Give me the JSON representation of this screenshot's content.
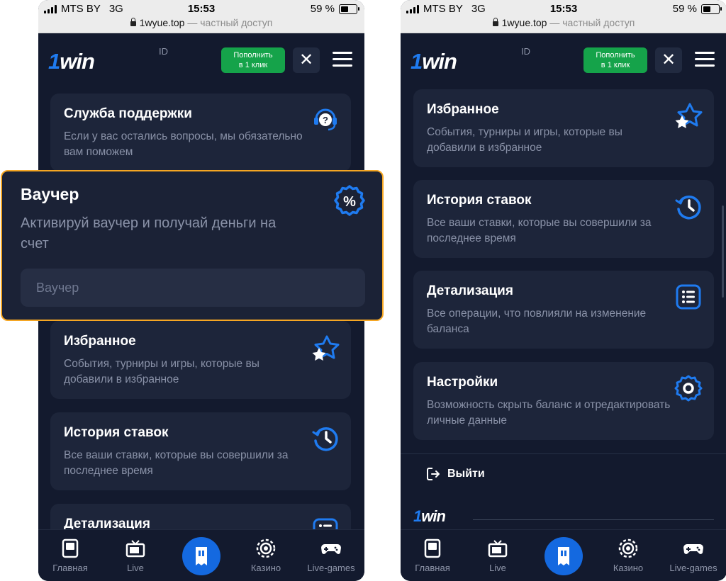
{
  "status_bar": {
    "carrier": "MTS BY",
    "network": "3G",
    "time": "15:53",
    "battery": "59 %",
    "url_domain": "1wyue.top",
    "url_suffix": "— частный доступ"
  },
  "header": {
    "logo_one": "1",
    "logo_win": "win",
    "id_label": "ID",
    "deposit_line1": "Пополнить",
    "deposit_line2": "в 1 клик",
    "close_symbol": "✕"
  },
  "left_cards": {
    "support": {
      "title": "Служба поддержки",
      "desc": "Если у вас остались вопросы, мы обязательно вам поможем",
      "icon": "headset-question-icon"
    },
    "favorites": {
      "title": "Избранное",
      "desc": "События, турниры и игры, которые вы добавили в избранное",
      "icon": "star-icon"
    },
    "history": {
      "title": "История ставок",
      "desc": "Все ваши ставки, которые вы совершили за последнее время",
      "icon": "history-clock-icon"
    },
    "details": {
      "title": "Детализация",
      "icon": "list-icon"
    }
  },
  "voucher": {
    "title": "Ваучер",
    "desc": "Активируй ваучер и получай деньги на счет",
    "placeholder": "Ваучер",
    "icon": "percent-badge-icon",
    "highlight_color": "#f5a623"
  },
  "right_cards": {
    "favorites": {
      "title": "Избранное",
      "desc": "События, турниры и игры, которые вы добавили в избранное",
      "icon": "star-icon"
    },
    "history": {
      "title": "История ставок",
      "desc": "Все ваши ставки, которые вы совершили за последнее время",
      "icon": "history-clock-icon"
    },
    "details": {
      "title": "Детализация",
      "desc": "Все операции, что повлияли на изменение баланса",
      "icon": "list-icon"
    },
    "settings": {
      "title": "Настройки",
      "desc": "Возможность скрыть баланс и отредактировать личные данные",
      "icon": "gear-icon"
    }
  },
  "logout": {
    "label": "Выйти",
    "icon": "logout-icon"
  },
  "footer": {
    "logo_one": "1",
    "logo_win": "win"
  },
  "bottom_nav": {
    "home": "Главная",
    "live": "Live",
    "casino": "Казино",
    "live_games": "Live-games"
  },
  "colors": {
    "background": "#131a2e",
    "card": "#1d253a",
    "accent_blue": "#1f7bf0",
    "deposit_green": "#15a34a"
  }
}
